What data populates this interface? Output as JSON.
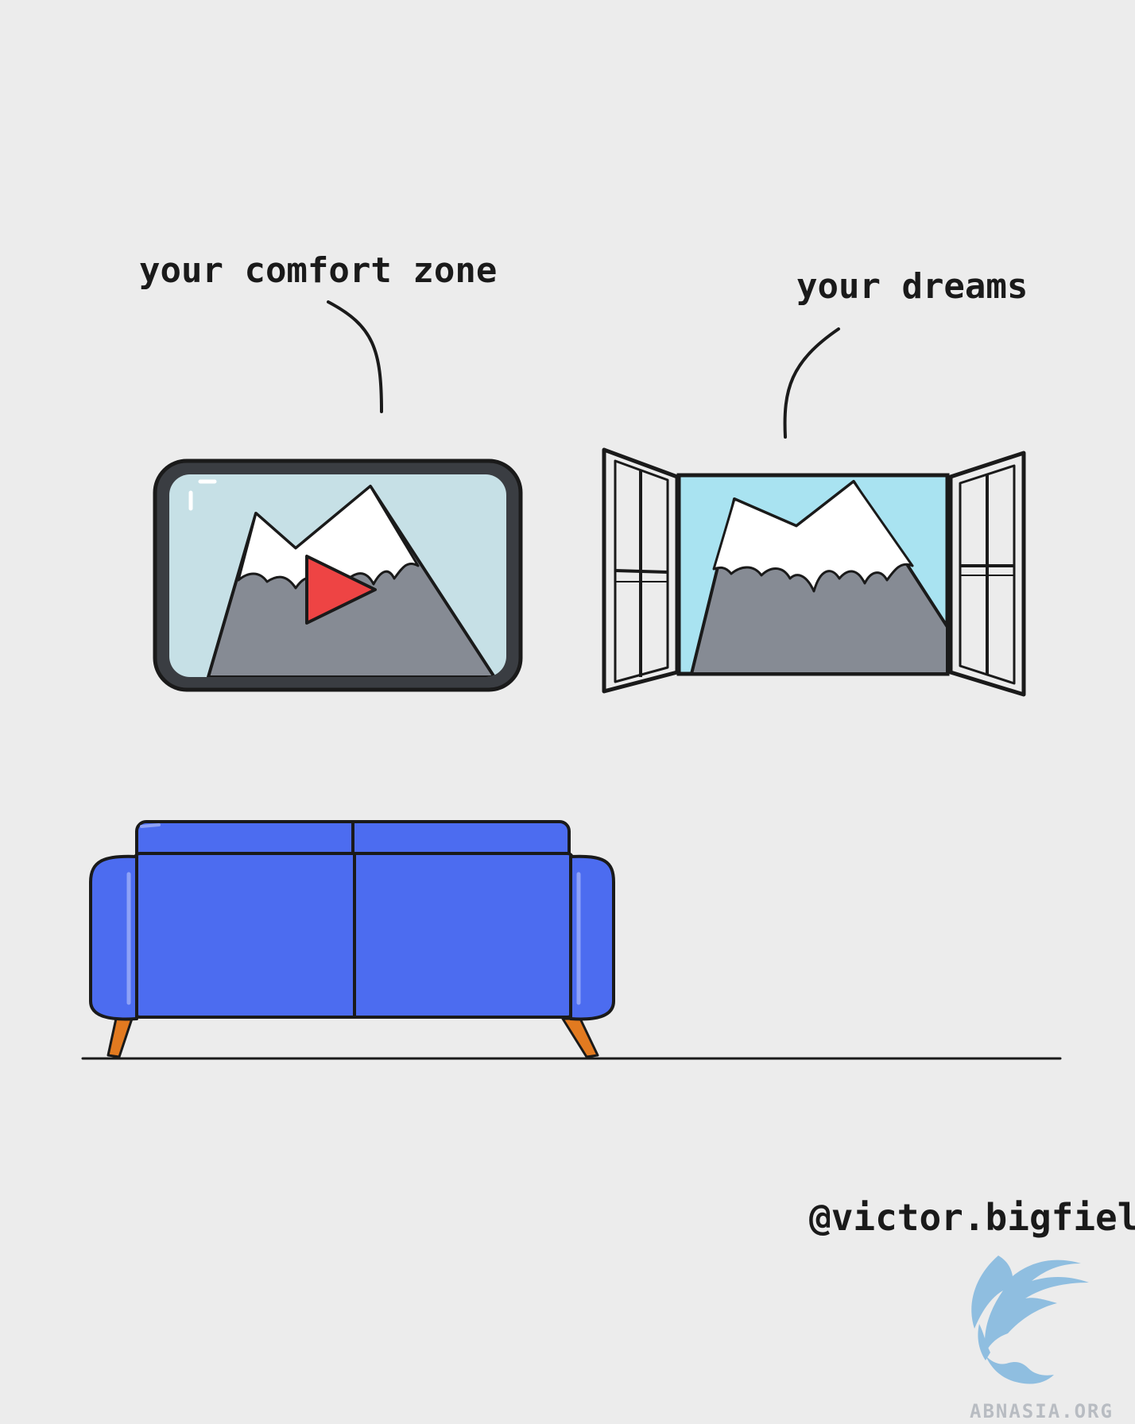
{
  "labels": {
    "comfort_zone": "your comfort zone",
    "dreams": "your dreams"
  },
  "credit": "@victor.bigfield",
  "watermark": {
    "text": "ABNASIA.ORG"
  },
  "icons": {
    "tv": "tv-screen-icon",
    "play": "play-icon",
    "window": "open-window-icon",
    "sofa": "sofa-icon",
    "logo": "griffin-logo-icon"
  },
  "colors": {
    "background": "#ececec",
    "outline": "#1a1a1a",
    "tv_sky": "#c6e0e6",
    "window_sky": "#a9e3f1",
    "mountain": "#868b94",
    "snow": "#ffffff",
    "play": "#ee4444",
    "sofa": "#4c6cf0",
    "sofa_highlight": "#8ea2f7",
    "legs": "#e27a20",
    "watermark": "#7fb6de"
  }
}
